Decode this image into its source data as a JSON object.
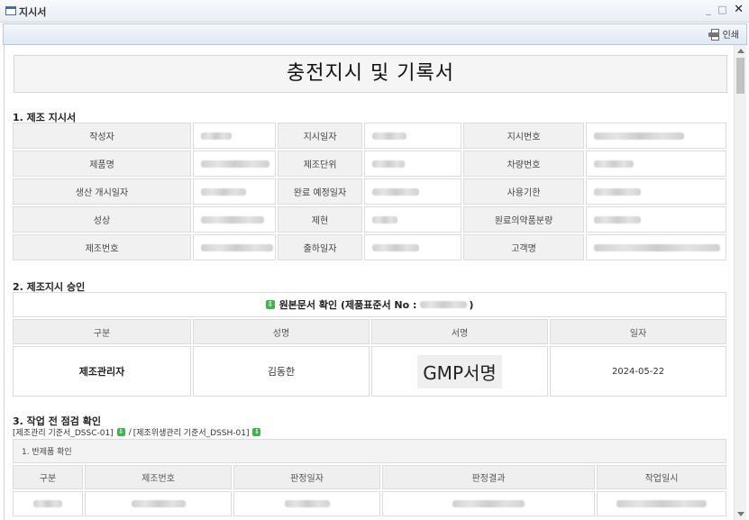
{
  "window": {
    "title": "지시서",
    "min_symbol": "_",
    "max_symbol": "□",
    "close_symbol": "✕"
  },
  "toolbar": {
    "print_label": "인쇄"
  },
  "doc": {
    "title": "충전지시 및 기록서"
  },
  "section1": {
    "title": "1. 제조 지시서",
    "rows": [
      [
        "작성자",
        "지시일자",
        "지시번호"
      ],
      [
        "제품명",
        "제조단위",
        "차량번호"
      ],
      [
        "생산 개시일자",
        "완료 예정일자",
        "사용기한"
      ],
      [
        "성상",
        "제현",
        "원료의약품분량"
      ],
      [
        "제조번호",
        "출하일자",
        "고객명"
      ]
    ]
  },
  "section2": {
    "title": "2. 제조지시 승인",
    "confirm_label": "원본문서 확인 (제품표준서 No :",
    "confirm_suffix": ")",
    "headers": [
      "구분",
      "성명",
      "서명",
      "일자"
    ],
    "row": {
      "role": "제조관리자",
      "name": "김동한",
      "signature": "GMP서명",
      "date": "2024-05-22"
    }
  },
  "section3": {
    "title": "3. 작업 전 점검 확인",
    "ref1": "[제조관리 기준서_DSSC-01]",
    "sep": "/",
    "ref2": "[제조위생관리 기준서_DSSH-01]",
    "sub_title": "1. 반제품 확인",
    "headers": [
      "구분",
      "제조번호",
      "판정일자",
      "판정결과",
      "작업일시"
    ]
  }
}
